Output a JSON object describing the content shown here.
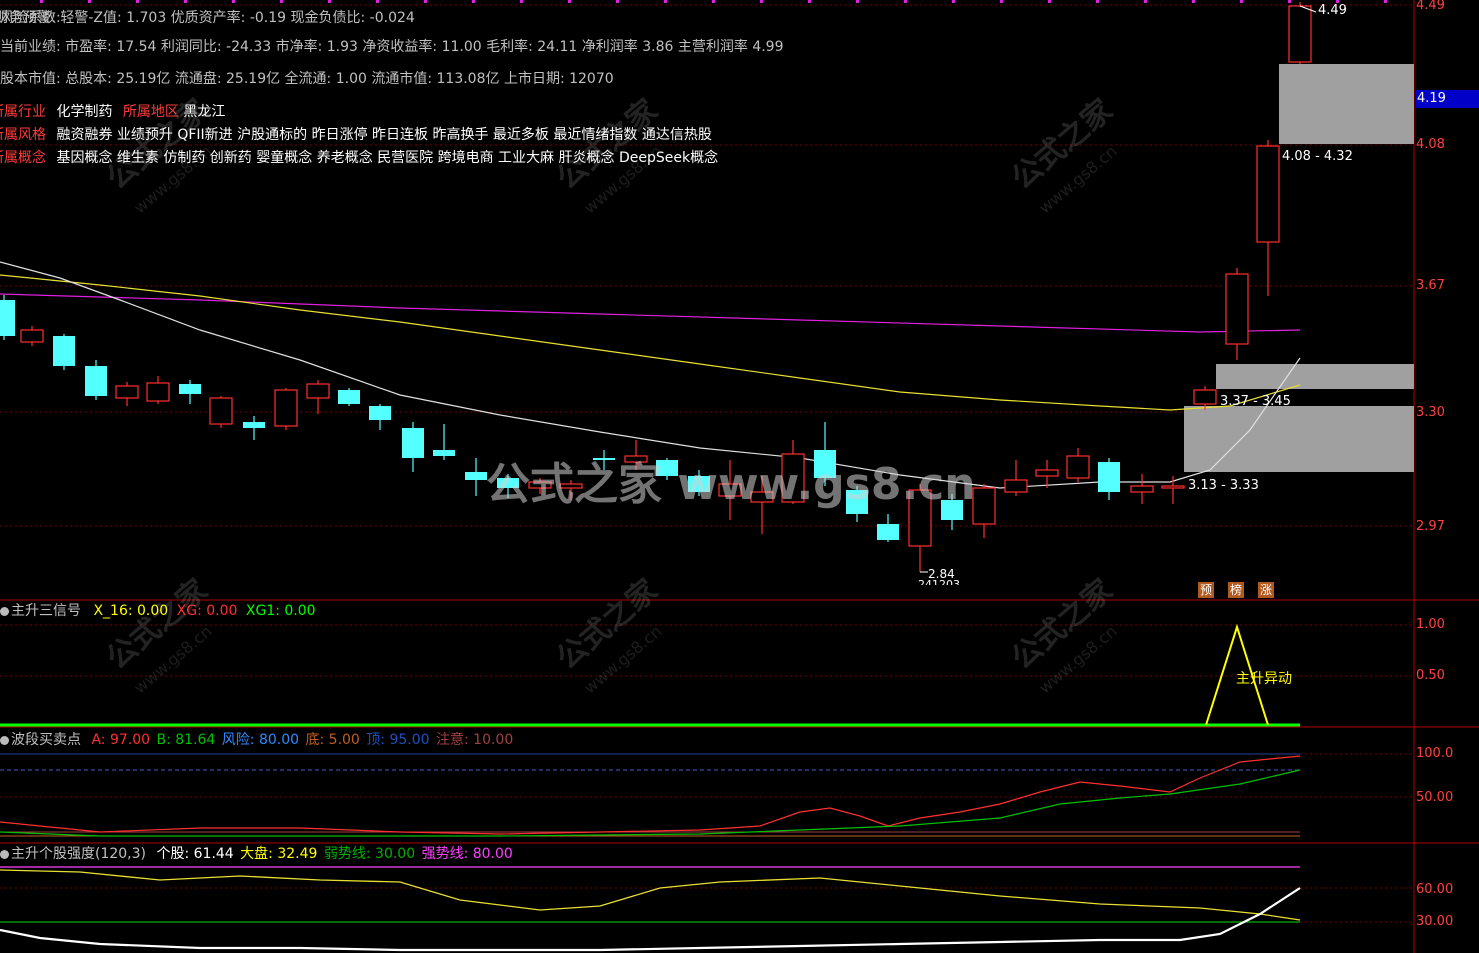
{
  "info": {
    "line1": [
      {
        "text": "风险系数: ",
        "c": "lbl"
      },
      {
        "text": "财务预警: 轻警-Z值: 1.703 优质资产率: -0.19 现金负债比: -0.024",
        "c": "lbl"
      }
    ],
    "line2": "当前业绩: 市盈率: 17.54 利润同比: -24.33 市净率: 1.93 净资收益率: 11.00 毛利率: 24.11 净利润率 3.86 主营利润率 4.99",
    "line3": "股本市值: 总股本: 25.19亿 流通盘: 25.19亿 全流通: 1.00 流通市值: 113.08亿 上市日期: 12070",
    "industry_label": "所属行业",
    "industry_value": "化学制药",
    "region_label": "所属地区",
    "region_value": "黑龙江",
    "style_label": "所属风格",
    "style_value": "融资融券 业绩预升 QFII新进 沪股通标的 昨日涨停 昨日连板 昨高换手 最近多板 最近情绪指数 通达信热股",
    "concept_label": "所属概念",
    "concept_value": "基因概念 维生素 仿制药 创新药 婴童概念 养老概念 民营医院 跨境电商 工业大麻 肝炎概念 DeepSeek概念"
  },
  "price_axis": [
    "4.49",
    "4.08",
    "3.67",
    "3.30",
    "2.97"
  ],
  "current_price": "4.19",
  "range_labels": {
    "high": "4.49",
    "upper_zone": "4.08 - 4.32",
    "mid_zone": "3.37 - 3.45",
    "lower_zone": "3.13 - 3.33",
    "low": "2.84",
    "low_date": "241203"
  },
  "signal_tags": [
    "预",
    "榜",
    "涨"
  ],
  "ind1": {
    "title": "主升三信号",
    "items": [
      {
        "label": "X_16: 0.00",
        "color": "#ffff00"
      },
      {
        "label": "XG: 0.00",
        "color": "#ff3030"
      },
      {
        "label": "XG1: 0.00",
        "color": "#00ff00"
      }
    ],
    "axis": [
      "1.00",
      "0.50"
    ],
    "annotation": "主升异动"
  },
  "ind2": {
    "title": "波段买卖点",
    "items": [
      {
        "label": "A: 97.00",
        "color": "#ff3030"
      },
      {
        "label": "B: 81.64",
        "color": "#00c000"
      },
      {
        "label": "风险: 80.00",
        "color": "#2e8bff"
      },
      {
        "label": "底: 5.00",
        "color": "#c06020"
      },
      {
        "label": "顶: 95.00",
        "color": "#2050c0"
      },
      {
        "label": "注意: 10.00",
        "color": "#a04040"
      }
    ],
    "axis": [
      "100.0",
      "50.00"
    ]
  },
  "ind3": {
    "title": "主升个股强度(120,3)",
    "items": [
      {
        "label": "个股: 61.44",
        "color": "#ffffff"
      },
      {
        "label": "大盘: 32.49",
        "color": "#ffff00"
      },
      {
        "label": "弱势线: 30.00",
        "color": "#00b000"
      },
      {
        "label": "强势线: 80.00",
        "color": "#ff40ff"
      }
    ],
    "axis": [
      "60.00",
      "30.00"
    ]
  },
  "watermark": {
    "big": "公式之家 www.gs8.cn",
    "small_cn": "公式之家",
    "small_url": "www.gs8.cn"
  },
  "colors": {
    "up": "#ff3030",
    "down": "#54ffff",
    "ma_white": "#e0e0e0",
    "ma_yellow": "#e8e030",
    "ma_magenta": "#e020e0",
    "axis_red": "#ff4040",
    "panel_border": "#b00000"
  }
}
